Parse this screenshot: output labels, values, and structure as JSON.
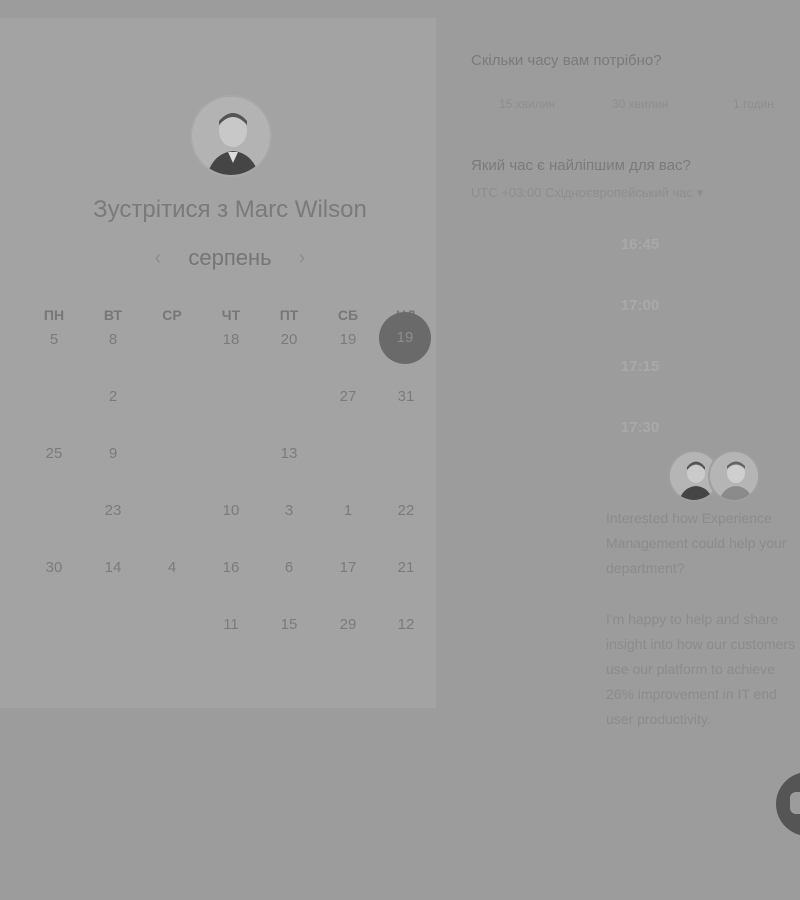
{
  "profile": {
    "title": "Зустрітися з Marc Wilson"
  },
  "calendar": {
    "month": "серпень",
    "weekdays": [
      "ПН",
      "ВТ",
      "СР",
      "ЧТ",
      "ПТ",
      "СБ",
      "НД"
    ],
    "today": "19",
    "rows": [
      [
        "5",
        "8",
        "",
        "18",
        "20",
        "19",
        ""
      ],
      [
        "",
        "2",
        "",
        "",
        "",
        "27",
        "31"
      ],
      [
        "25",
        "9",
        "",
        "",
        "13",
        "",
        ""
      ],
      [
        "",
        "23",
        "",
        "10",
        "3",
        "1",
        "22"
      ],
      [
        "30",
        "14",
        "4",
        "16",
        "6",
        "17",
        "21"
      ],
      [
        "",
        "",
        "",
        "11",
        "15",
        "29",
        "12"
      ]
    ]
  },
  "booking": {
    "duration_question": "Скільки часу вам потрібно?",
    "durations": [
      "15 хвилин",
      "30 хвилин",
      "1 годин"
    ],
    "time_question": "Який час є найліпшим для вас?",
    "timezone": "UTC +03:00 Східноєвропейський час ▾",
    "slots": [
      "16:45",
      "17:00",
      "17:15",
      "17:30"
    ]
  },
  "promo": {
    "line1": "Interested how Experience Management could help your department?",
    "line2": "I'm happy to help and share insight into how our customers use our platform to achieve 26% improvement in IT end user productivity."
  },
  "colors": {
    "today_circle": "#6a6a6a",
    "overlay": "#9c9c9c"
  },
  "icons": {
    "prev": "chevron-left-icon",
    "next": "chevron-right-icon",
    "chat": "chat-icon"
  }
}
